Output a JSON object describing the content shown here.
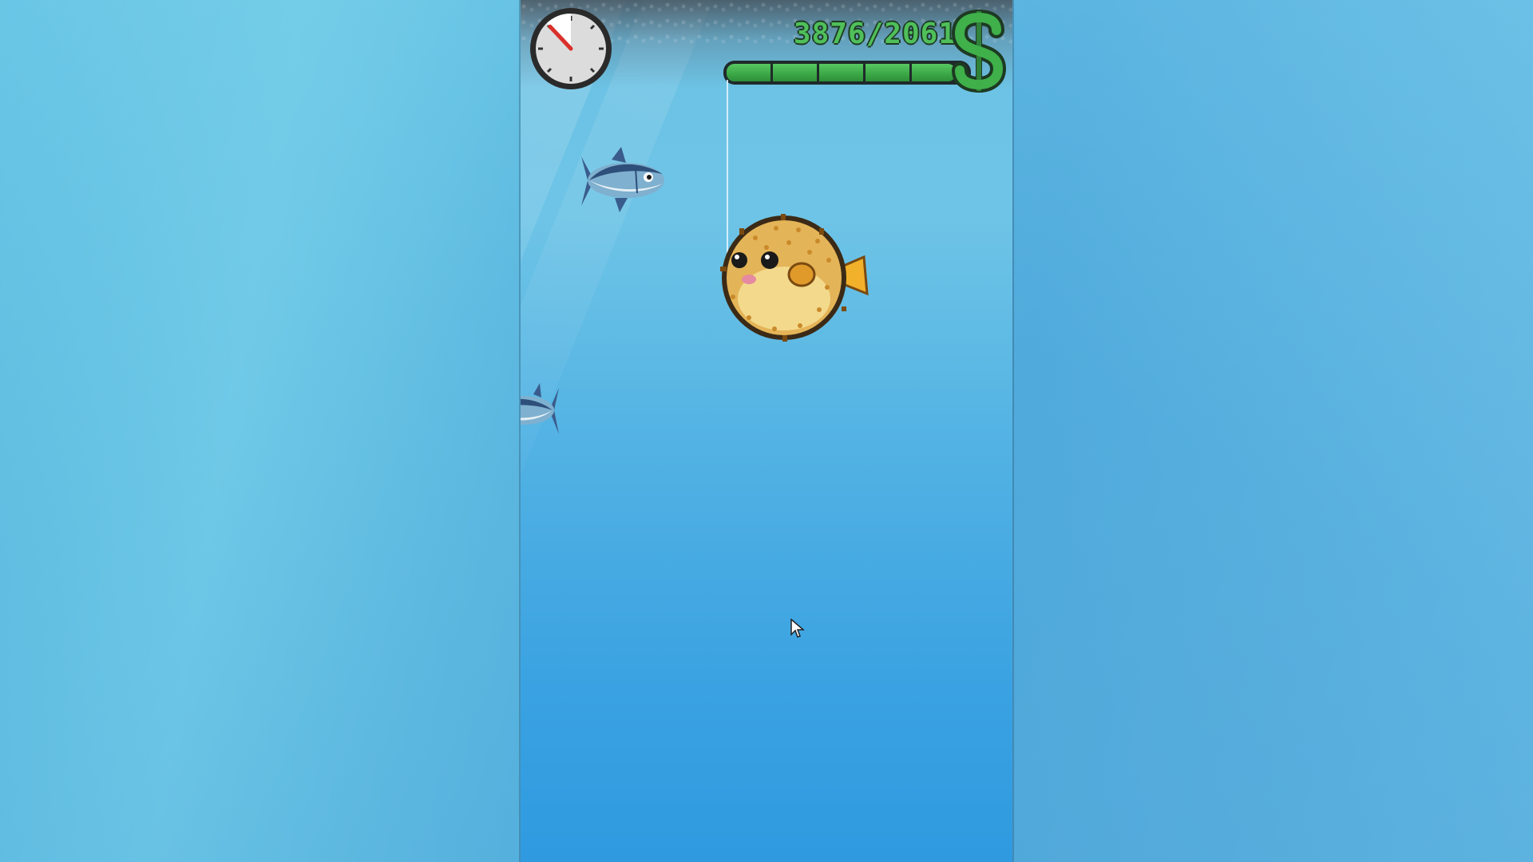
{
  "hud": {
    "money_text": "3876/2061",
    "progress_fraction": 0.95,
    "timer_fraction": 0.12,
    "timer_icon": "stopwatch-icon",
    "currency_icon": "dollar-sign-icon"
  },
  "scene": {
    "caught_fish": "pufferfish",
    "swimming_fish": [
      "tuna",
      "tuna"
    ]
  },
  "colors": {
    "money_green": "#4fbf5a",
    "progress_green": "#3fae4a",
    "timer_red": "#d9302a",
    "water_top": "#6cc2e4",
    "water_bottom": "#2f9ae0"
  }
}
